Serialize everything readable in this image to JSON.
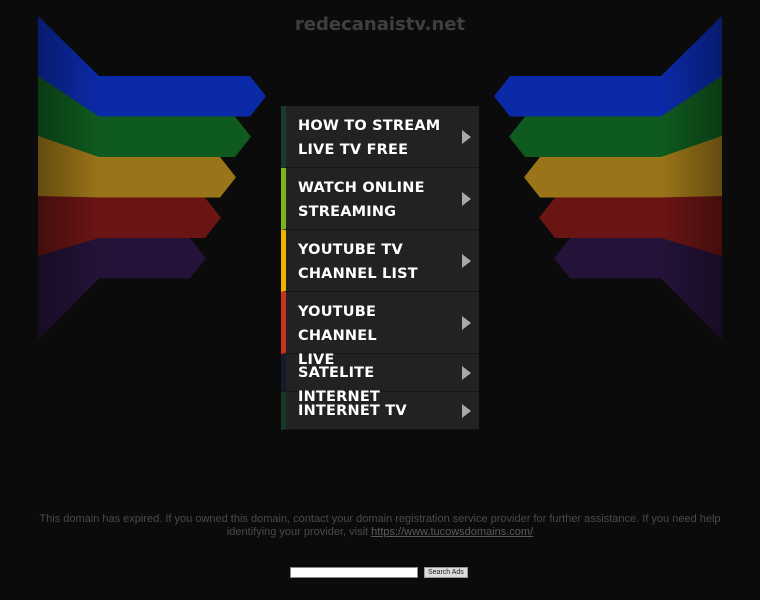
{
  "site": {
    "title": "redecanaistv.net"
  },
  "menu": {
    "items": [
      {
        "line1": "HOW TO STREAM",
        "line2": "LIVE TV FREE",
        "accent": "#1a3a2a"
      },
      {
        "line1": "WATCH ONLINE",
        "line2": "STREAMING",
        "accent": "#7fb21b"
      },
      {
        "line1": "YOUTUBE TV",
        "line2": "CHANNEL LIST",
        "accent": "#f0b000"
      },
      {
        "line1": "YOUTUBE CHANNEL",
        "line2": "LIVE",
        "accent": "#c8321e"
      },
      {
        "line1": "SATELITE INTERNET",
        "line2": "",
        "accent": "#161a2e"
      },
      {
        "line1": "INTERNET TV",
        "line2": "",
        "accent": "#163a26"
      }
    ]
  },
  "stripes": [
    {
      "color": "#0b2aa8"
    },
    {
      "color": "#0f5a1e"
    },
    {
      "color": "#9a7418"
    },
    {
      "color": "#6a1414"
    },
    {
      "color": "#241238"
    }
  ],
  "notice": {
    "text": "This domain has expired. If you owned this domain, contact your domain registration service provider for further assistance. If you need help identifying your provider, visit ",
    "link": "https://www.tucowsdomains.com/"
  },
  "search": {
    "placeholder": "",
    "button_label": "Search Ads"
  }
}
